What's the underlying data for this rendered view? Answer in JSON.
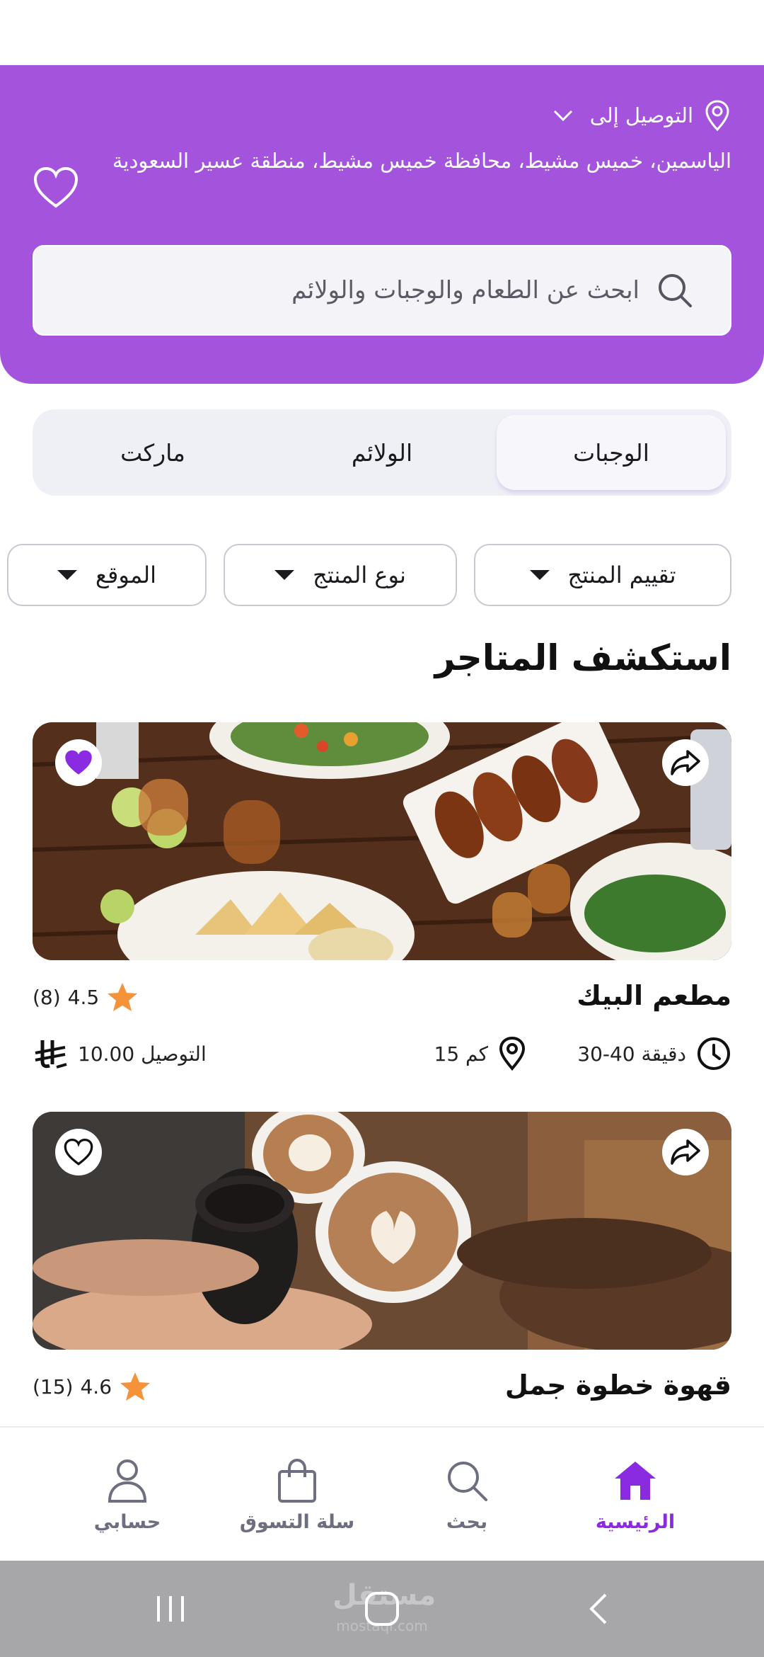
{
  "header": {
    "deliver_label": "التوصيل إلى",
    "address": "الياسمين، خميس مشيط، محافظة خميس مشيط، منطقة عسير السعودية",
    "search_placeholder": "ابحث عن الطعام والوجبات والولائم"
  },
  "segments": [
    {
      "label": "الوجبات",
      "active": true
    },
    {
      "label": "الولائم",
      "active": false
    },
    {
      "label": "ماركت",
      "active": false
    }
  ],
  "filters": [
    {
      "label": "تقييم المنتج"
    },
    {
      "label": "نوع المنتج"
    },
    {
      "label": "الموقع"
    }
  ],
  "section_title": "استكشف المتاجر",
  "stores": [
    {
      "name": "مطعم البيك",
      "rating": "4.5",
      "reviews": "(8)",
      "time": "30-40 دقيقة",
      "distance": "15 كم",
      "delivery_fee": "التوصيل 10.00",
      "favorite": true
    },
    {
      "name": "قهوة خطوة جمل",
      "rating": "4.6",
      "reviews": "(15)",
      "favorite": false
    }
  ],
  "bottom_nav": [
    {
      "label": "الرئيسية",
      "icon": "home-icon",
      "active": true
    },
    {
      "label": "بحث",
      "icon": "search-icon",
      "active": false
    },
    {
      "label": "سلة التسوق",
      "icon": "shopping-bag-icon",
      "active": false
    },
    {
      "label": "حسابي",
      "icon": "user-icon",
      "active": false
    }
  ],
  "watermark": {
    "text": "مستقل",
    "sub": "mostaql.com"
  },
  "colors": {
    "header_bg": "#a453dd",
    "accent": "#8a2be2",
    "star": "#f5933a",
    "nav_inactive": "#6d6f80",
    "system_bar": "#a7a7a9"
  }
}
